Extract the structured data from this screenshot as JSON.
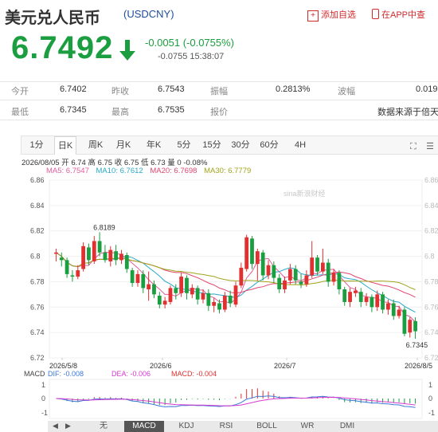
{
  "header": {
    "title": "美元兑人民币",
    "code": "(USDCNY)",
    "add_watch": "添加自选",
    "app_link": "在APP中查"
  },
  "quote": {
    "price": "6.7492",
    "change": "-0.0051 (-0.0755%)",
    "sub_line": "-0.0755 15:38:07",
    "color": "#1a9e3f"
  },
  "stats": {
    "row1": [
      {
        "label": "今开",
        "value": "6.7402"
      },
      {
        "label": "昨收",
        "value": "6.7543"
      },
      {
        "label": "振幅",
        "value": "0.2813%"
      },
      {
        "label": "波幅",
        "value": "0.019"
      }
    ],
    "row2": [
      {
        "label": "最低",
        "value": "6.7345"
      },
      {
        "label": "最高",
        "value": "6.7535"
      },
      {
        "label": "报价",
        "value": ""
      },
      {
        "label": "",
        "value": "数据来源于倍天"
      }
    ]
  },
  "period_tabs": [
    "1分",
    "日K",
    "周K",
    "月K",
    "年K",
    "5分",
    "15分",
    "30分",
    "60分",
    "4H"
  ],
  "active_period": "日K",
  "info_line": "2026/08/05  开 6.74  高 6.75  收 6.75  低 6.73  量 0  -0.08%",
  "ma_line": [
    {
      "label": "MA5: 6.7547",
      "color": "#e05a9c"
    },
    {
      "label": "MA10: 6.7612",
      "color": "#2aa8c9"
    },
    {
      "label": "MA20: 6.7698",
      "color": "#e0456f"
    },
    {
      "label": "MA30: 6.7779",
      "color": "#a0a41a"
    }
  ],
  "watermark": "sina新浪财经",
  "chart_data": {
    "type": "candlestick",
    "ylim": [
      6.72,
      6.86
    ],
    "y_ticks": [
      "6.86",
      "6.84",
      "6.82",
      "6.8",
      "6.78",
      "6.76",
      "6.74",
      "6.72"
    ],
    "x_tick_labels": [
      "2026/5/8",
      "2026/6",
      "2026/7",
      "2026/8/5"
    ],
    "annotations": {
      "high_label": "6.8189",
      "low_label": "6.7345"
    },
    "up_color": "#e0302f",
    "down_color": "#1a9e3f",
    "candles": [
      [
        6.802,
        6.803,
        6.796,
        6.806
      ],
      [
        6.799,
        6.797,
        6.792,
        6.803
      ],
      [
        6.797,
        6.786,
        6.783,
        6.799
      ],
      [
        6.785,
        6.784,
        6.78,
        6.789
      ],
      [
        6.784,
        6.789,
        6.782,
        6.793
      ],
      [
        6.79,
        6.808,
        6.788,
        6.811
      ],
      [
        6.807,
        6.797,
        6.793,
        6.81
      ],
      [
        6.796,
        6.812,
        6.794,
        6.816
      ],
      [
        6.812,
        6.803,
        6.8,
        6.819
      ],
      [
        6.803,
        6.797,
        6.795,
        6.809
      ],
      [
        6.796,
        6.805,
        6.792,
        6.808
      ],
      [
        6.804,
        6.797,
        6.793,
        6.809
      ],
      [
        6.797,
        6.802,
        6.794,
        6.805
      ],
      [
        6.801,
        6.79,
        6.787,
        6.803
      ],
      [
        6.789,
        6.779,
        6.776,
        6.791
      ],
      [
        6.779,
        6.786,
        6.776,
        6.789
      ],
      [
        6.786,
        6.775,
        6.771,
        6.789
      ],
      [
        6.774,
        6.778,
        6.765,
        6.788
      ],
      [
        6.778,
        6.77,
        6.767,
        6.781
      ],
      [
        6.769,
        6.762,
        6.759,
        6.772
      ],
      [
        6.762,
        6.765,
        6.759,
        6.768
      ],
      [
        6.764,
        6.775,
        6.762,
        6.777
      ],
      [
        6.775,
        6.771,
        6.766,
        6.778
      ],
      [
        6.771,
        6.784,
        6.768,
        6.787
      ],
      [
        6.783,
        6.771,
        6.766,
        6.785
      ],
      [
        6.77,
        6.775,
        6.767,
        6.778
      ],
      [
        6.775,
        6.766,
        6.762,
        6.777
      ],
      [
        6.766,
        6.771,
        6.763,
        6.774
      ],
      [
        6.771,
        6.761,
        6.757,
        6.774
      ],
      [
        6.761,
        6.764,
        6.756,
        6.767
      ],
      [
        6.763,
        6.758,
        6.755,
        6.766
      ],
      [
        6.758,
        6.769,
        6.756,
        6.772
      ],
      [
        6.769,
        6.763,
        6.76,
        6.773
      ],
      [
        6.762,
        6.777,
        6.76,
        6.78
      ],
      [
        6.777,
        6.791,
        6.775,
        6.795
      ],
      [
        6.79,
        6.815,
        6.788,
        6.817
      ],
      [
        6.814,
        6.794,
        6.79,
        6.816
      ],
      [
        6.794,
        6.804,
        6.781,
        6.806
      ],
      [
        6.803,
        6.785,
        6.781,
        6.805
      ],
      [
        6.785,
        6.793,
        6.782,
        6.797
      ],
      [
        6.793,
        6.783,
        6.779,
        6.796
      ],
      [
        6.783,
        6.774,
        6.771,
        6.786
      ],
      [
        6.774,
        6.781,
        6.771,
        6.784
      ],
      [
        6.781,
        6.79,
        6.778,
        6.794
      ],
      [
        6.79,
        6.781,
        6.778,
        6.793
      ],
      [
        6.78,
        6.778,
        6.775,
        6.786
      ],
      [
        6.778,
        6.785,
        6.776,
        6.789
      ],
      [
        6.785,
        6.799,
        6.783,
        6.812
      ],
      [
        6.799,
        6.788,
        6.785,
        6.801
      ],
      [
        6.788,
        6.795,
        6.786,
        6.806
      ],
      [
        6.795,
        6.78,
        6.776,
        6.798
      ],
      [
        6.78,
        6.787,
        6.777,
        6.79
      ],
      [
        6.787,
        6.774,
        6.77,
        6.789
      ],
      [
        6.774,
        6.764,
        6.761,
        6.776
      ],
      [
        6.764,
        6.772,
        6.76,
        6.775
      ],
      [
        6.771,
        6.773,
        6.768,
        6.776
      ],
      [
        6.772,
        6.764,
        6.76,
        6.775
      ],
      [
        6.764,
        6.768,
        6.761,
        6.771
      ],
      [
        6.768,
        6.76,
        6.756,
        6.77
      ],
      [
        6.76,
        6.77,
        6.757,
        6.773
      ],
      [
        6.77,
        6.758,
        6.755,
        6.772
      ],
      [
        6.758,
        6.763,
        6.754,
        6.766
      ],
      [
        6.763,
        6.753,
        6.75,
        6.766
      ],
      [
        6.753,
        6.758,
        6.751,
        6.761
      ],
      [
        6.758,
        6.739,
        6.737,
        6.76
      ],
      [
        6.74,
        6.75,
        6.736,
        6.752
      ],
      [
        6.749,
        6.741,
        6.735,
        6.752
      ]
    ],
    "macd": {
      "dif_label": "DIF: -0.008",
      "dea_label": "DEA: -0.006",
      "macd_label": "MACD: -0.004",
      "dif_color": "#3b78d8",
      "dea_color": "#d63ad0",
      "y_ticks": [
        "1",
        "0",
        "-1"
      ]
    }
  },
  "indicator_tabs": [
    "无",
    "MACD",
    "KDJ",
    "RSI",
    "BOLL",
    "WR",
    "DMI"
  ],
  "active_indicator": "MACD",
  "nav_arrows": [
    "◀",
    "▶"
  ]
}
